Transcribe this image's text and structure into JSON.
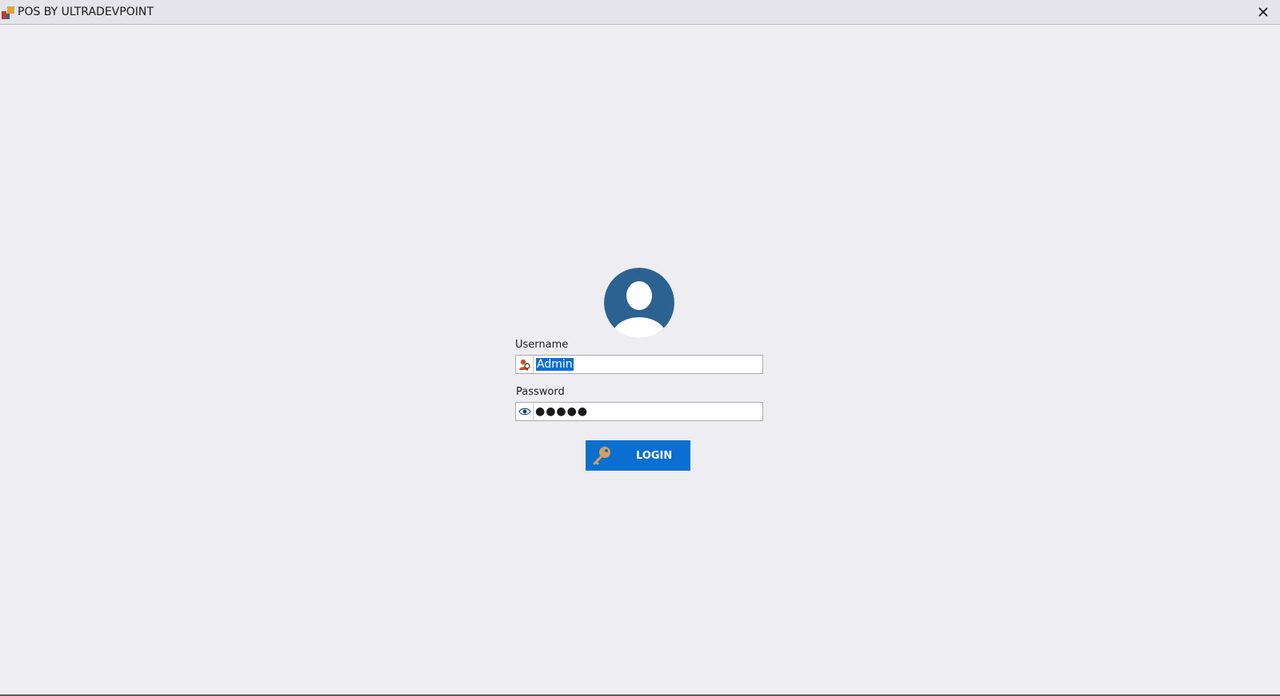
{
  "window": {
    "title": "POS BY ULTRADEVPOINT",
    "close_glyph": "✕"
  },
  "login": {
    "username_label": "Username",
    "username_value": "Admin",
    "password_label": "Password",
    "password_mask": "●●●●●",
    "login_button_label": "LOGIN"
  },
  "icons": {
    "app": "app-logo-icon",
    "avatar": "user-avatar-icon",
    "username": "user-icon",
    "password": "eye-icon",
    "login": "key-icon"
  },
  "colors": {
    "background": "#eeeef2",
    "accent": "#0a6fd0",
    "avatar": "#2c6292",
    "selection": "#0a6fd6"
  }
}
